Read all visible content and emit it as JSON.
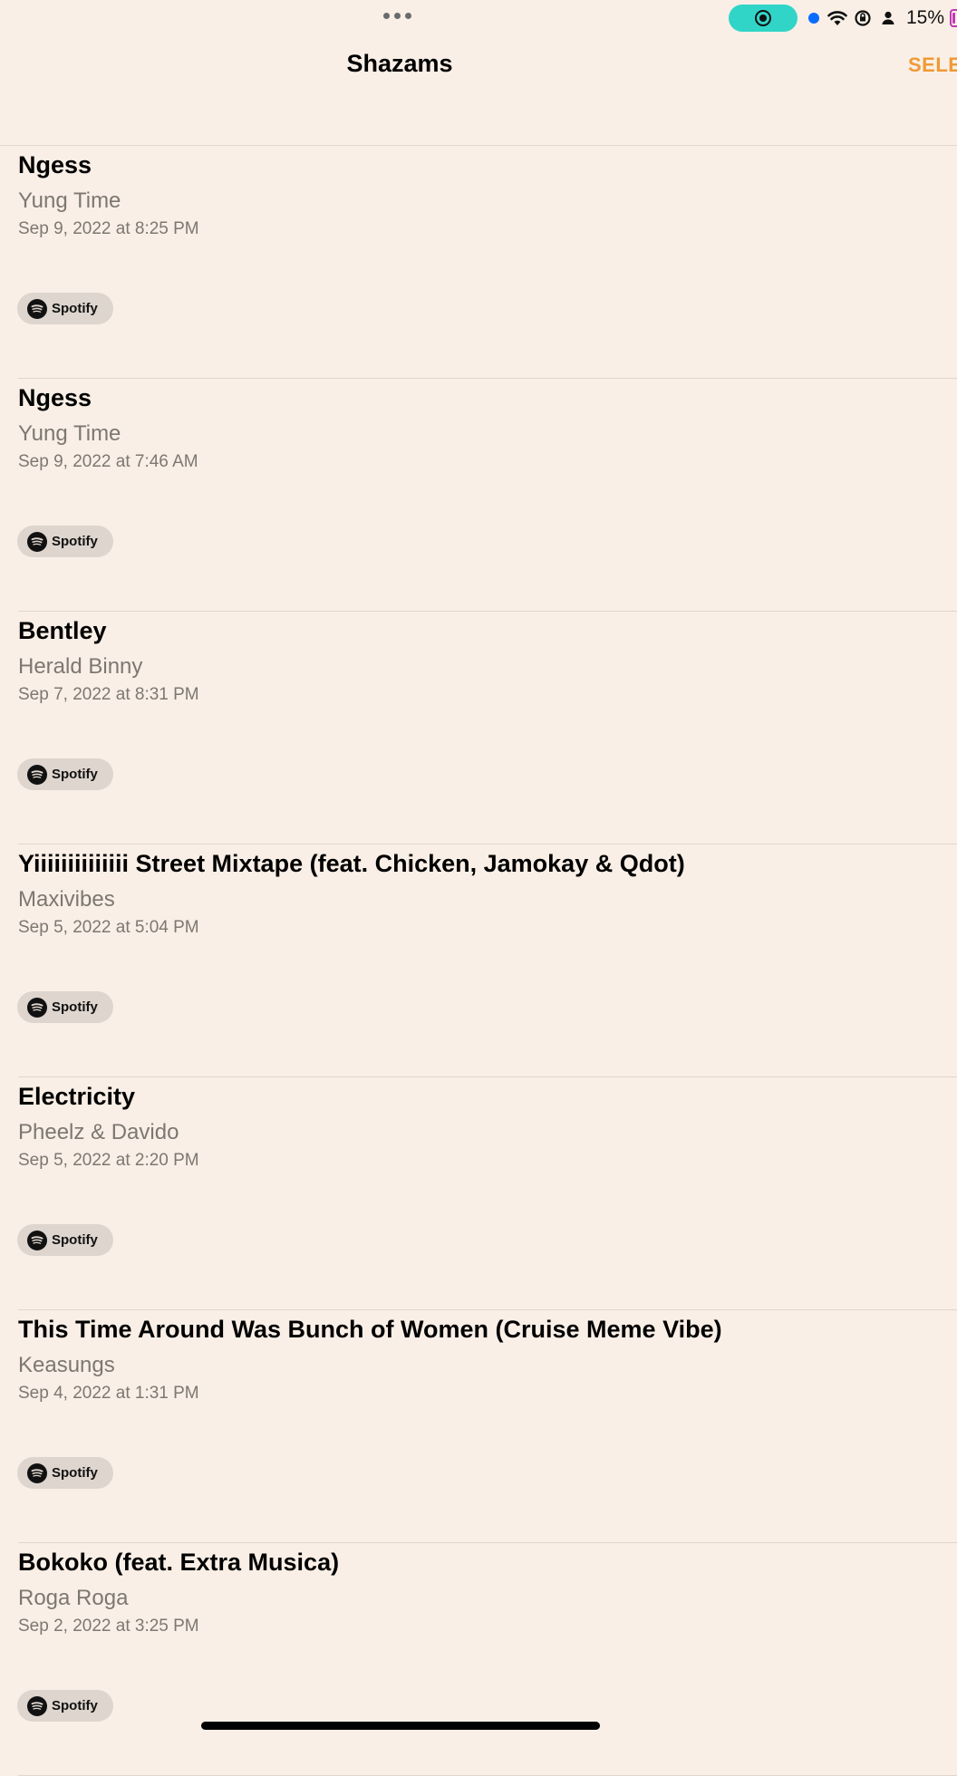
{
  "nav": {
    "title": "Shazams",
    "select_label": "SELE"
  },
  "status": {
    "battery": "15%"
  },
  "colors": {
    "background": "#f9efe6",
    "accent": "#f09a35",
    "screen_record": "#30d5c8"
  },
  "items": [
    {
      "title": "Ngess",
      "artist": "Yung Time",
      "date": "Sep 9, 2022 at 8:25 PM",
      "service": "Spotify"
    },
    {
      "title": "Ngess",
      "artist": "Yung Time",
      "date": "Sep 9, 2022 at 7:46 AM",
      "service": "Spotify"
    },
    {
      "title": "Bentley",
      "artist": "Herald Binny",
      "date": "Sep 7, 2022 at 8:31 PM",
      "service": "Spotify"
    },
    {
      "title": "Yiiiiiiiiiiiiii Street Mixtape (feat. Chicken, Jamokay & Qdot)",
      "artist": "Maxivibes",
      "date": "Sep 5, 2022 at 5:04 PM",
      "service": "Spotify"
    },
    {
      "title": "Electricity",
      "artist": "Pheelz & Davido",
      "date": "Sep 5, 2022 at 2:20 PM",
      "service": "Spotify"
    },
    {
      "title": "This Time Around Was Bunch of Women (Cruise Meme Vibe)",
      "artist": "Keasungs",
      "date": "Sep 4, 2022 at 1:31 PM",
      "service": "Spotify"
    },
    {
      "title": "Bokoko (feat. Extra Musica)",
      "artist": "Roga Roga",
      "date": "Sep 2, 2022 at 3:25 PM",
      "service": "Spotify"
    }
  ]
}
